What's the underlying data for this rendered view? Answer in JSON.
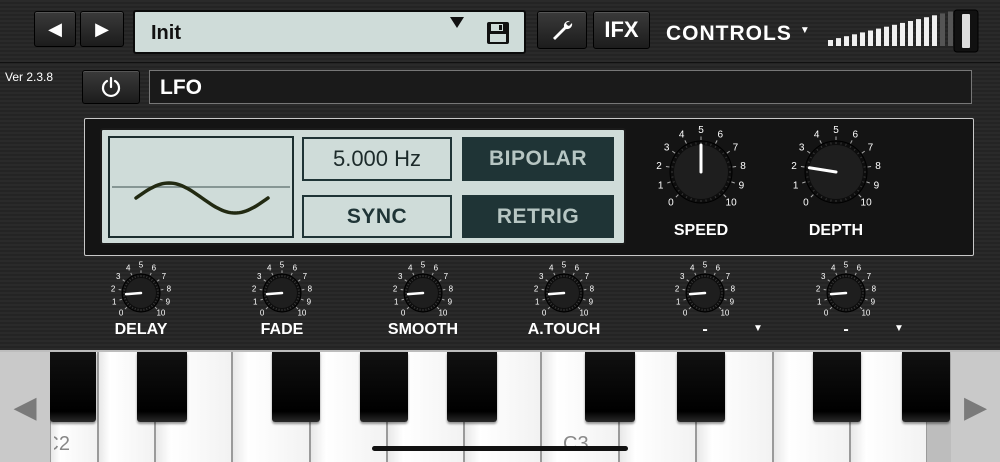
{
  "header": {
    "prev_label": "◀",
    "next_label": "▶",
    "preset_name": "Init",
    "settings_label": "",
    "ifx_label": "IFX",
    "controls_label": "CONTROLS",
    "volume_level": 0.85
  },
  "version": "Ver 2.3.8",
  "module": {
    "name": "LFO"
  },
  "lfo": {
    "rate": "5.000 Hz",
    "bipolar": "BIPOLAR",
    "sync": "SYNC",
    "retrig": "RETRIG",
    "waveform": "sine"
  },
  "big_knobs": [
    {
      "label": "SPEED",
      "value": 5.0
    },
    {
      "label": "DEPTH",
      "value": 2.0
    }
  ],
  "small_knobs": [
    {
      "label": "DELAY",
      "value": 1.5,
      "has_menu": false
    },
    {
      "label": "FADE",
      "value": 1.5,
      "has_menu": false
    },
    {
      "label": "SMOOTH",
      "value": 1.5,
      "has_menu": false
    },
    {
      "label": "A.TOUCH",
      "value": 1.5,
      "has_menu": false
    },
    {
      "label": "-",
      "value": 1.5,
      "has_menu": true
    },
    {
      "label": "-",
      "value": 1.5,
      "has_menu": true
    }
  ],
  "knob_scale": [
    "0",
    "1",
    "2",
    "3",
    "4",
    "5",
    "6",
    "7",
    "8",
    "9",
    "10"
  ],
  "keyboard": {
    "left_arrow": "◀",
    "right_arrow": "▶",
    "note_left": "C2",
    "note_center": "C3"
  },
  "colors": {
    "lcd_bg": "#cfdcd9",
    "lcd_dark": "#1f3436",
    "lcd_dark_text": "#b7c6c3",
    "wave": "#222a12"
  }
}
